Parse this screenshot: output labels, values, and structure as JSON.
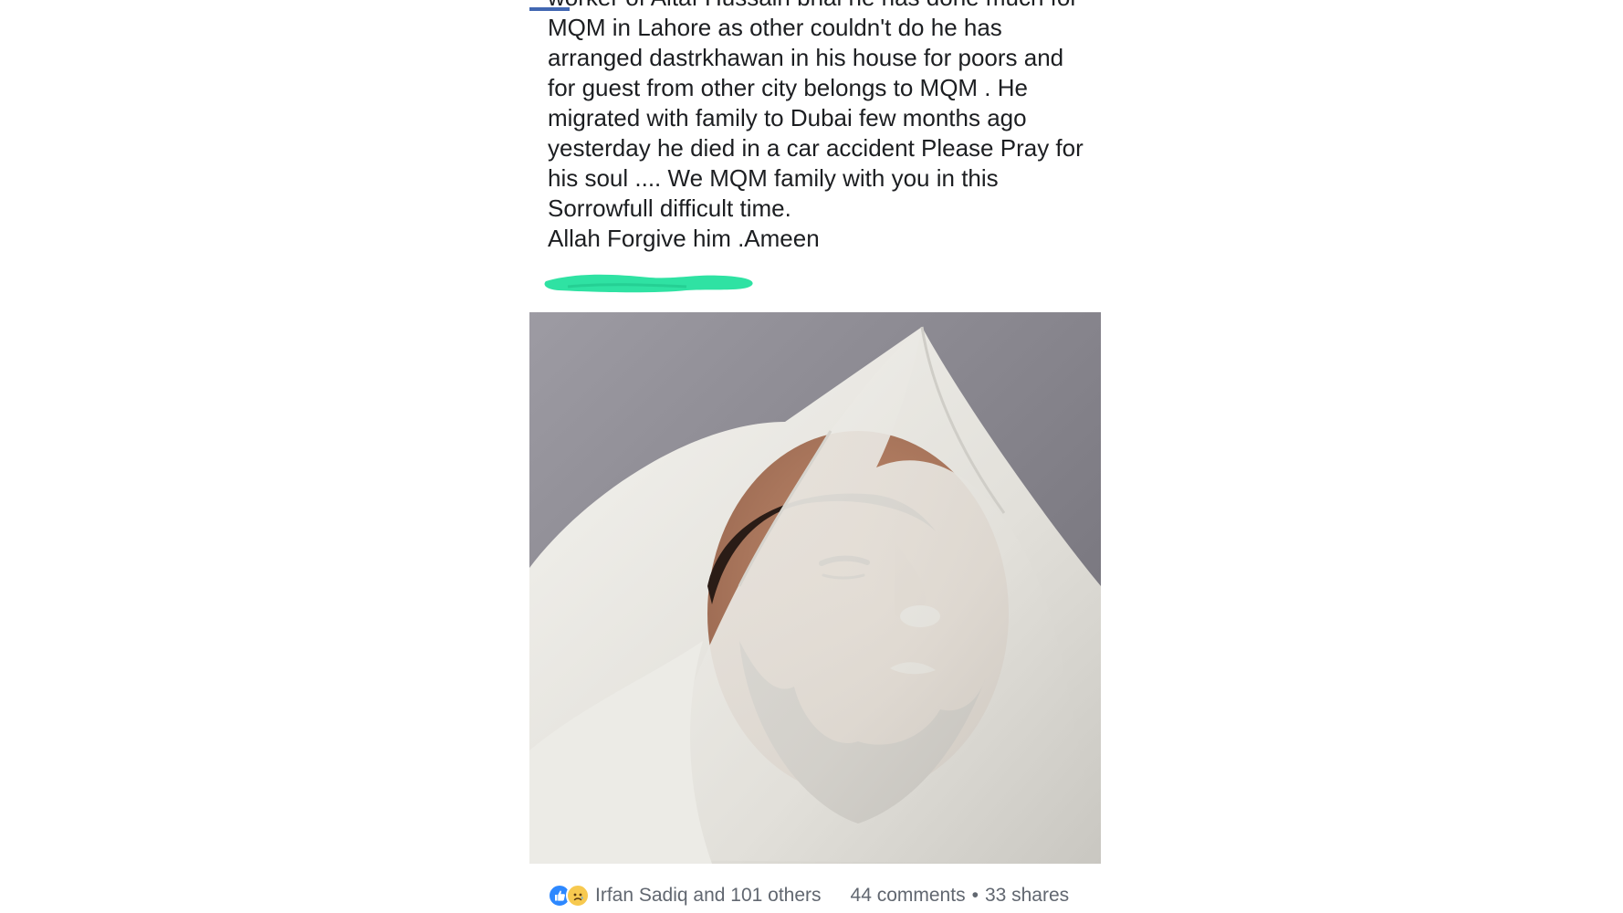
{
  "post": {
    "text_lines": [
      "worker of Altaf Hussain bhai he has done much for",
      "MQM in Lahore as other couldn't do he has",
      "arranged dastrkhawan in his house for poors and",
      "for guest from other city belongs to MQM . He",
      "migrated with family to Dubai few months ago",
      "yesterday he died in a car accident Please Pray for",
      "his soul .... We MQM family with you in this",
      "Sorrowfull difficult time.",
      "Allah Forgive him .Ameen"
    ],
    "redaction_color": "#2fe2a3"
  },
  "colors": {
    "accent": "#4267b2",
    "text": "#1c1e21",
    "meta": "#616770",
    "like": "#2d88ff",
    "sad": "#f7c94f"
  },
  "photo": {
    "icon": "photo-icon"
  },
  "footer": {
    "reaction_icons": [
      "like-icon",
      "sad-icon"
    ],
    "reactors": "Irfan Sadiq and 101 others",
    "comments": "44 comments",
    "separator": "•",
    "shares": "33 shares"
  }
}
